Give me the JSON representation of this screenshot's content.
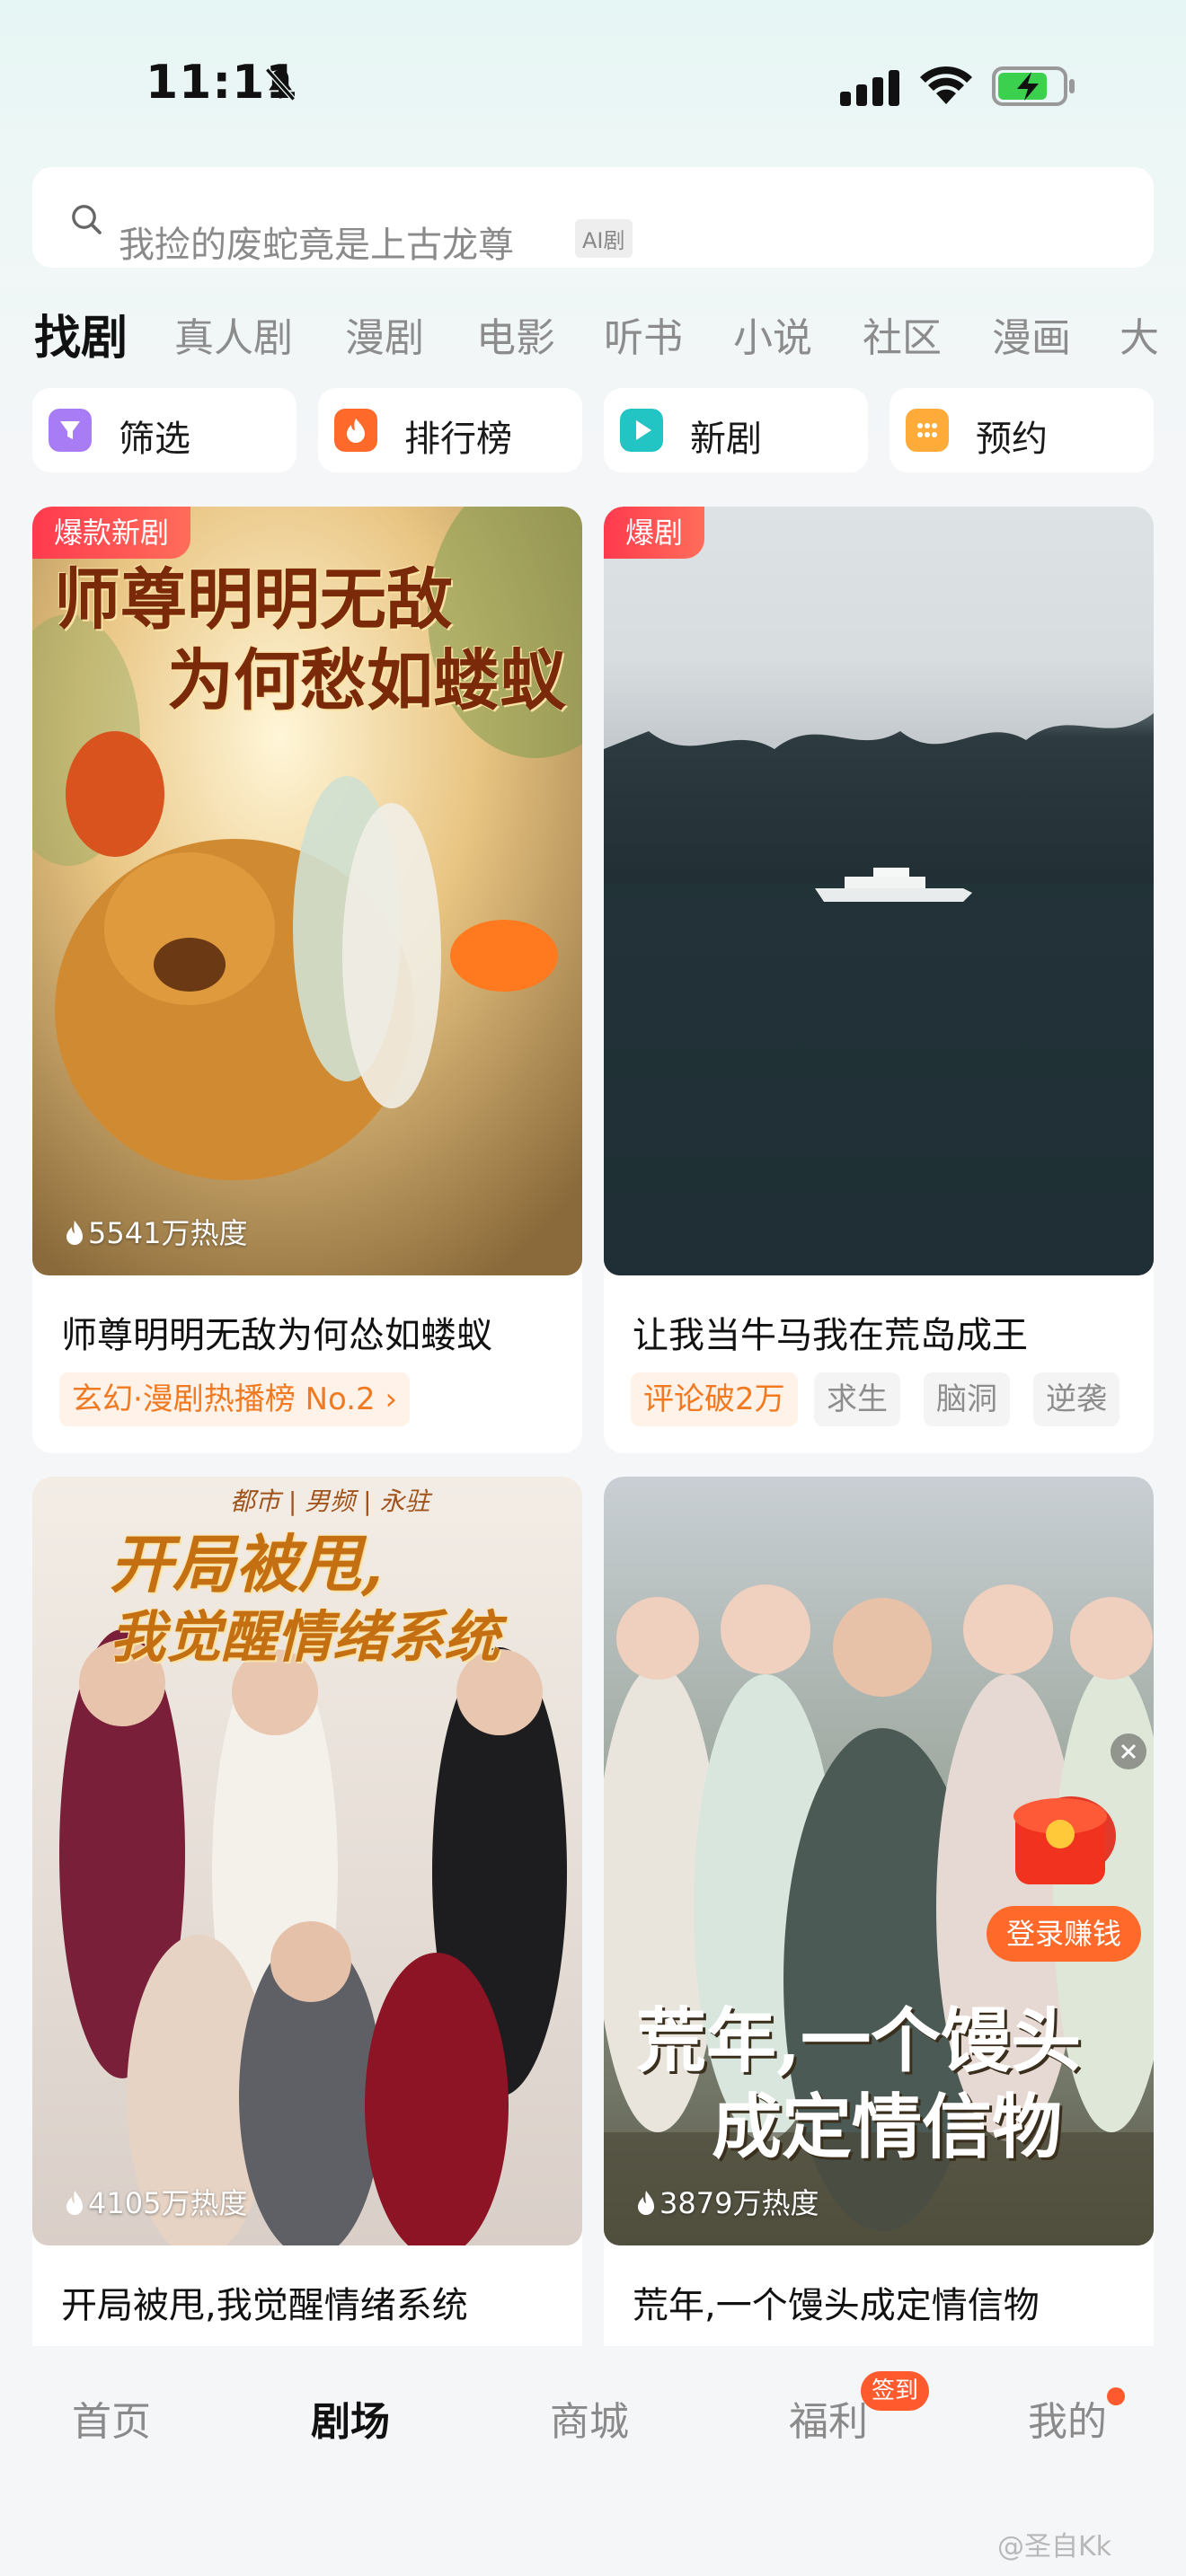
{
  "status_bar": {
    "time": "11:11"
  },
  "search": {
    "placeholder": "我捡的废蛇竟是上古龙尊",
    "tag": "AI剧"
  },
  "tabs": [
    "找剧",
    "真人剧",
    "漫剧",
    "电影",
    "听书",
    "小说",
    "社区",
    "漫画",
    "大"
  ],
  "chips": [
    {
      "label": "筛选",
      "icon": "filter-icon",
      "color": "#a77cf5"
    },
    {
      "label": "排行榜",
      "icon": "fire-icon",
      "color": "#ff6a2b"
    },
    {
      "label": "新剧",
      "icon": "play-icon",
      "color": "#22c4c4"
    },
    {
      "label": "预约",
      "icon": "grid-icon",
      "color": "#ffab3a"
    }
  ],
  "cards": [
    {
      "badge": "爆款新剧",
      "poster_title": [
        "师尊明明无敌",
        "为何愁如蝼蚁"
      ],
      "heat": "5541万热度",
      "title": "师尊明明无敌为何怂如蝼蚁",
      "rank_tag": "玄幻·漫剧热播榜 No.2 ›"
    },
    {
      "badge": "爆剧",
      "title": "让我当牛马我在荒岛成王",
      "tags": [
        "评论破2万",
        "求生",
        "脑洞",
        "逆袭"
      ]
    },
    {
      "poster_title": [
        "开局被甩,",
        "我觉醒情绪系统"
      ],
      "poster_subtitle": "都市 | 男频 | 永驻",
      "heat": "4105万热度",
      "title": "开局被甩,我觉醒情绪系统"
    },
    {
      "poster_title": [
        "荒年,一个馒头",
        "成定情信物"
      ],
      "heat": "3879万热度",
      "title": "荒年,一个馒头成定情信物",
      "login_earn": "登录赚钱"
    }
  ],
  "bottom_nav": [
    "首页",
    "剧场",
    "商城",
    "福利",
    "我的"
  ],
  "bottom_nav_active": "剧场",
  "sign_badge": "签到",
  "watermark": "@圣自Kk",
  "colors": {
    "accent": "#ff5a2e",
    "badge_red": "#ff3a4e",
    "tag_orange": "#f07a22"
  }
}
